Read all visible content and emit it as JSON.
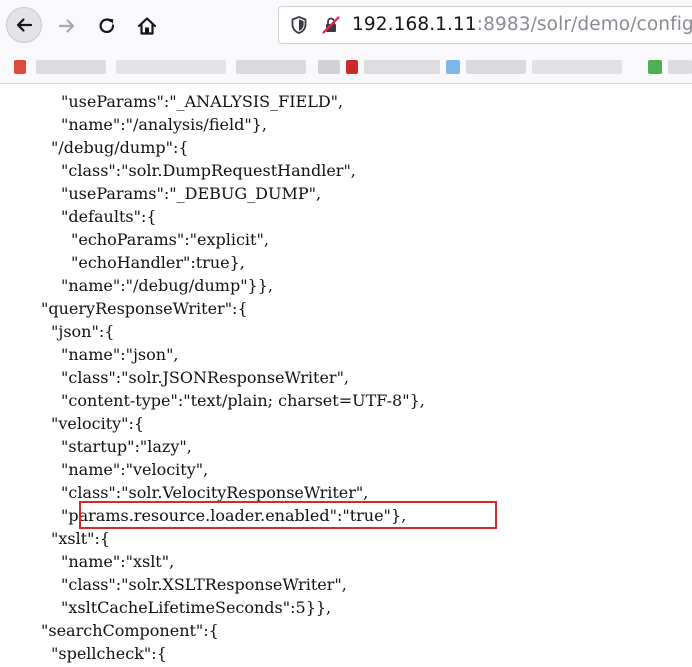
{
  "browser": {
    "url_host": "192.168.1.11",
    "url_rest": ":8983/solr/demo/config",
    "icons": {
      "back": "back-arrow-icon",
      "forward": "forward-arrow-icon",
      "reload": "reload-icon",
      "home": "home-icon",
      "shield": "tracking-shield-icon",
      "insecure": "insecure-connection-icon"
    }
  },
  "json_lines": [
    {
      "indent": 5,
      "text": "\"useParams\":\"_ANALYSIS_FIELD\","
    },
    {
      "indent": 5,
      "text": "\"name\":\"/analysis/field\"},"
    },
    {
      "indent": 4,
      "text": "\"/debug/dump\":{"
    },
    {
      "indent": 5,
      "text": "\"class\":\"solr.DumpRequestHandler\","
    },
    {
      "indent": 5,
      "text": "\"useParams\":\"_DEBUG_DUMP\","
    },
    {
      "indent": 5,
      "text": "\"defaults\":{"
    },
    {
      "indent": 6,
      "text": "\"echoParams\":\"explicit\","
    },
    {
      "indent": 6,
      "text": "\"echoHandler\":true},"
    },
    {
      "indent": 5,
      "text": "\"name\":\"/debug/dump\"}},"
    },
    {
      "indent": 3,
      "text": "\"queryResponseWriter\":{"
    },
    {
      "indent": 4,
      "text": "\"json\":{"
    },
    {
      "indent": 5,
      "text": "\"name\":\"json\","
    },
    {
      "indent": 5,
      "text": "\"class\":\"solr.JSONResponseWriter\","
    },
    {
      "indent": 5,
      "text": "\"content-type\":\"text/plain; charset=UTF-8\"},"
    },
    {
      "indent": 4,
      "text": "\"velocity\":{"
    },
    {
      "indent": 5,
      "text": "\"startup\":\"lazy\","
    },
    {
      "indent": 5,
      "text": "\"name\":\"velocity\","
    },
    {
      "indent": 5,
      "text": "\"class\":\"solr.VelocityResponseWriter\","
    },
    {
      "indent": 5,
      "text": "\"params.resource.loader.enabled\":\"true\"},"
    },
    {
      "indent": 4,
      "text": "\"xslt\":{"
    },
    {
      "indent": 5,
      "text": "\"name\":\"xslt\","
    },
    {
      "indent": 5,
      "text": "\"class\":\"solr.XSLTResponseWriter\","
    },
    {
      "indent": 5,
      "text": "\"xsltCacheLifetimeSeconds\":5}},"
    },
    {
      "indent": 3,
      "text": "\"searchComponent\":{"
    },
    {
      "indent": 4,
      "text": "\"spellcheck\":{"
    }
  ],
  "highlighted_line_index": 18,
  "colors": {
    "highlight_border": "#d52a2a",
    "insecure_red": "#e22850"
  }
}
